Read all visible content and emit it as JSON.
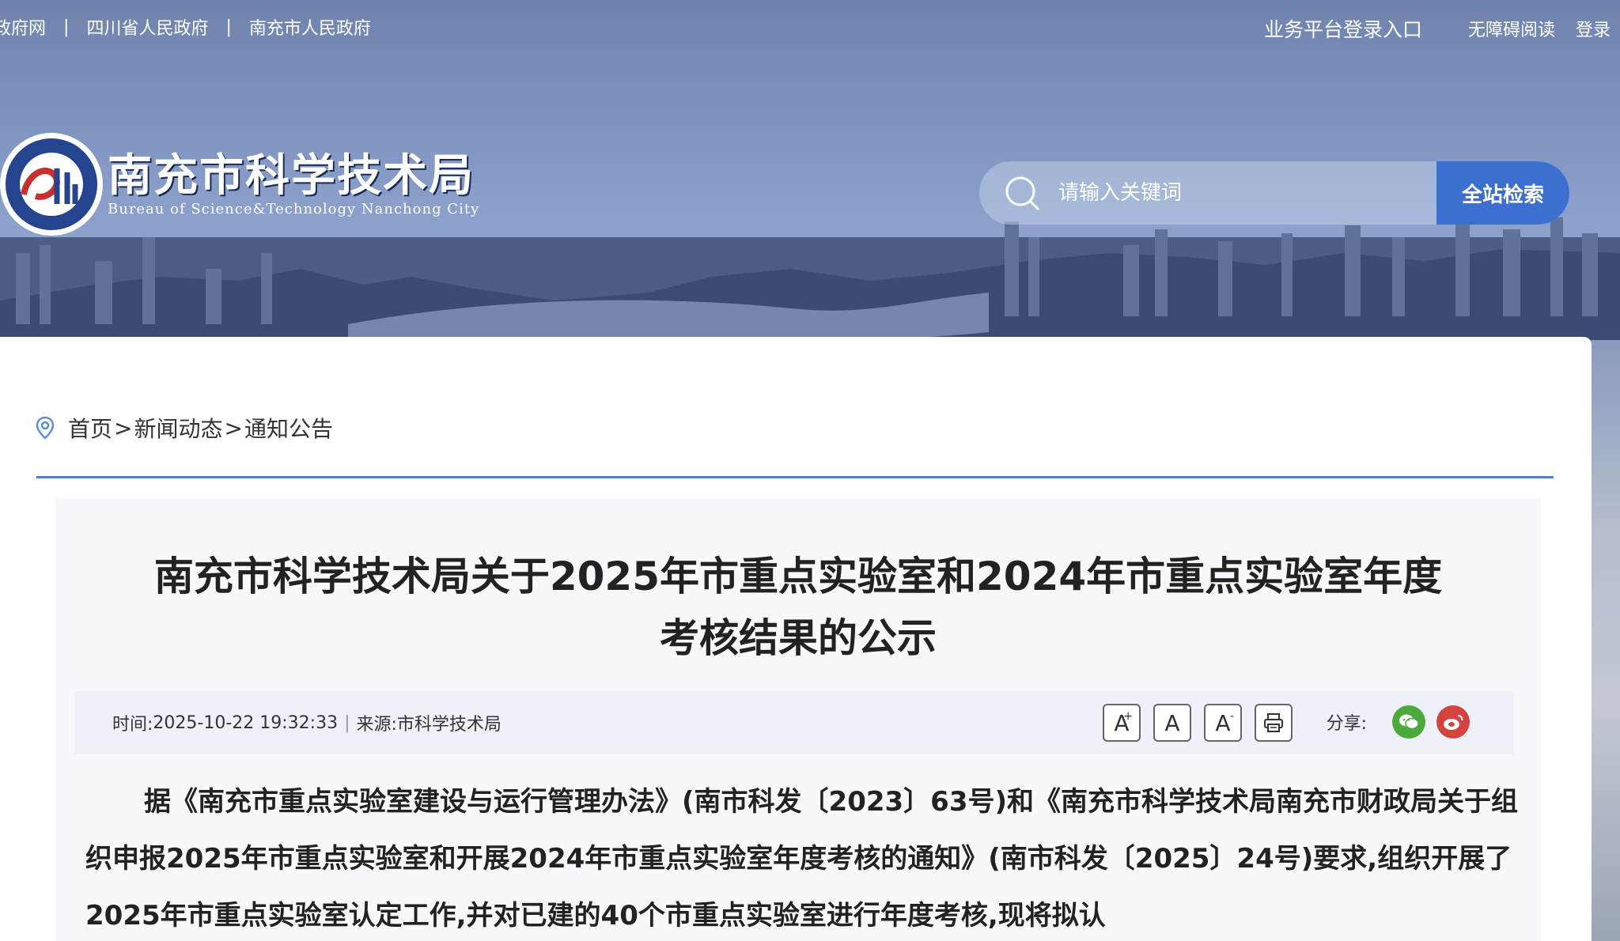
{
  "topbar": {
    "links": [
      "四川省人民政府网站群",
      "四川省人民政府",
      "南充市人民政府"
    ],
    "links_visible": [
      "政府网",
      "四川省人民政府",
      "南充市人民政府"
    ],
    "separator": "|",
    "business_login": "业务平台登录入口",
    "accessibility": "无障碍阅读",
    "login": "登录"
  },
  "logo": {
    "cn": "南充市科学技术局",
    "en": "Bureau of Science&Technology Nanchong City"
  },
  "search": {
    "placeholder": "请输入关键词",
    "button": "全站检索"
  },
  "breadcrumb": {
    "items": [
      "首页",
      "新闻动态",
      "通知公告"
    ],
    "separator": ">"
  },
  "article": {
    "title": "南充市科学技术局关于2025年市重点实验室和2024年市重点实验室年度考核结果的公示",
    "time_label": "时间:",
    "time": "2025-10-22 19:32:33",
    "source_label": "来源:",
    "source": "市科学技术局",
    "tools": {
      "font_increase": "A",
      "font_normal": "A",
      "font_decrease": "A"
    },
    "share_label": "分享:",
    "body": "据《南充市重点实验室建设与运行管理办法》(南市科发〔2023〕63号)和《南充市科学技术局南充市财政局关于组织申报2025年市重点实验室和开展2024年市重点实验室年度考核的通知》(南市科发〔2025〕24号)要求,组织开展了2025年市重点实验室认定工作,并对已建的40个市重点实验室进行年度考核,现将拟认"
  },
  "colors": {
    "accent": "#3d6fd1",
    "rule": "#5b7bd0",
    "wechat": "#4caa3c",
    "weibo": "#d5433e"
  }
}
